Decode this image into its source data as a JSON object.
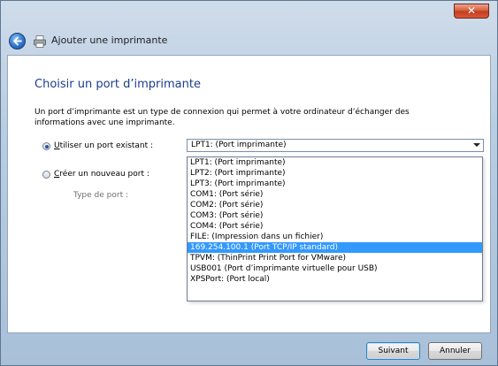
{
  "window": {
    "close_glyph": "✕",
    "title": "Ajouter une imprimante"
  },
  "page": {
    "heading": "Choisir un port d’imprimante",
    "description": "Un port d’imprimante est un type de connexion qui permet à votre ordinateur d’échanger des informations avec une imprimante."
  },
  "options": {
    "existing": {
      "accel": "U",
      "label_rest": "tiliser un port existant :",
      "checked": true
    },
    "new": {
      "accel": "C",
      "label_rest": "réer un nouveau port :",
      "checked": false
    },
    "port_type_label": "Type de port :"
  },
  "combo": {
    "selected": "LPT1: (Port imprimante)"
  },
  "dropdown": {
    "items": [
      "LPT1: (Port imprimante)",
      "LPT2: (Port imprimante)",
      "LPT3: (Port imprimante)",
      "COM1: (Port série)",
      "COM2: (Port série)",
      "COM3: (Port série)",
      "COM4: (Port série)",
      "FILE: (Impression dans un fichier)",
      "169.254.100.1 (Port TCP/IP standard)",
      "TPVM: (ThinPrint Print Port for VMware)",
      "USB001 (Port d’imprimante virtuelle pour USB)",
      "XPSPort: (Port local)"
    ],
    "highlighted_index": 8
  },
  "buttons": {
    "next": "Suivant",
    "cancel": "Annuler"
  },
  "colors": {
    "heading": "#1e3c8c",
    "highlight": "#3399ff"
  }
}
